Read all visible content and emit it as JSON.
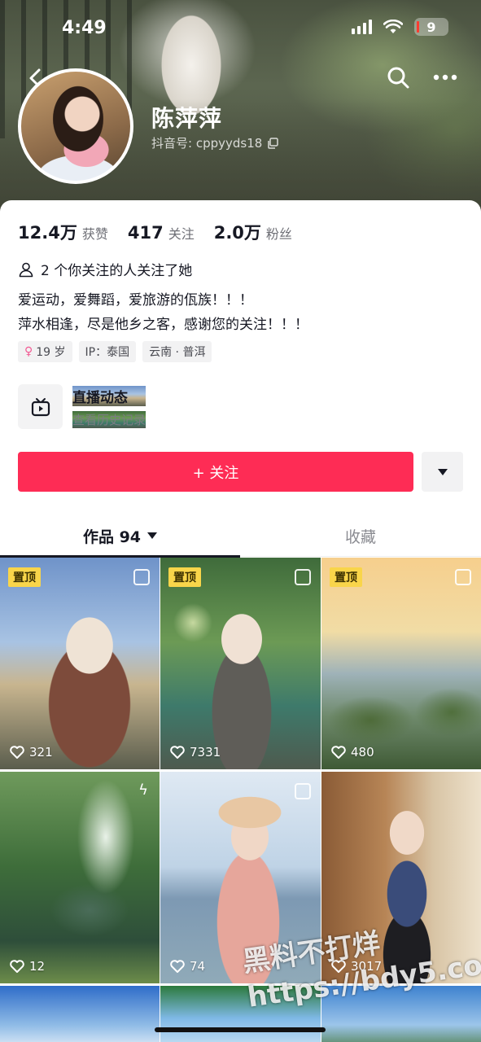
{
  "status_bar": {
    "time": "4:49",
    "battery": "9"
  },
  "profile": {
    "nickname": "陈萍萍",
    "douyin_id": "抖音号: cppyyds18"
  },
  "stats": [
    {
      "value": "12.4万",
      "label": "获赞"
    },
    {
      "value": "417",
      "label": "关注"
    },
    {
      "value": "2.0万",
      "label": "粉丝"
    }
  ],
  "mutual_follow": "2 个你关注的人关注了她",
  "bio": [
    "爱运动，爱舞蹈，爱旅游的佤族！！！",
    "萍水相逢，尽是他乡之客，感谢您的关注！！！"
  ],
  "tags": {
    "age": "19 岁",
    "ip": "IP：泰国",
    "location": "云南 · 普洱"
  },
  "live": {
    "title": "直播动态",
    "subtitle": "查看历史记录"
  },
  "follow_button": "+ 关注",
  "tabs": {
    "works": "作品 94",
    "favorites": "收藏"
  },
  "grid": [
    {
      "pinned": "置顶",
      "likes": "321",
      "icon": "multi-image-icon"
    },
    {
      "pinned": "置顶",
      "likes": "7331",
      "icon": "multi-image-icon"
    },
    {
      "pinned": "置顶",
      "likes": "480",
      "icon": "multi-image-icon"
    },
    {
      "pinned": "",
      "likes": "12",
      "icon": "live-photo-icon"
    },
    {
      "pinned": "",
      "likes": "74",
      "icon": "multi-image-icon"
    },
    {
      "pinned": "",
      "likes": "3017",
      "icon": ""
    }
  ],
  "watermark": {
    "line1": "黑料不打烊",
    "line2": "https://bdy5.co"
  },
  "colors": {
    "accent": "#fe2c55",
    "pin_badge": "#f9d54a"
  }
}
